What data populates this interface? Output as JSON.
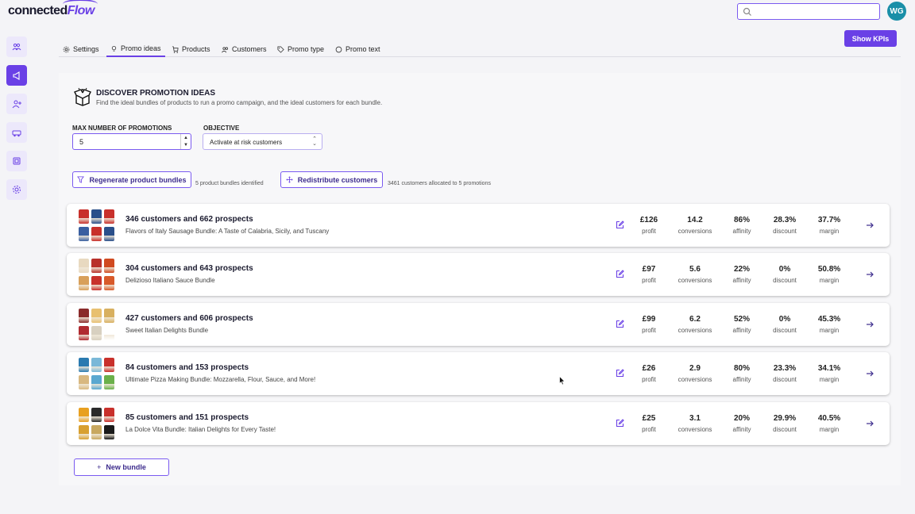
{
  "app": {
    "logo_main": "connected",
    "logo_accent": "Flow"
  },
  "header": {
    "search_placeholder": "",
    "avatar_initials": "WG",
    "show_kpis_label": "Show KPIs"
  },
  "sidebar": {
    "items": [
      {
        "icon": "people-icon",
        "active": false
      },
      {
        "icon": "megaphone-icon",
        "active": true
      },
      {
        "icon": "add-user-icon",
        "active": false
      },
      {
        "icon": "car-icon",
        "active": false
      },
      {
        "icon": "grid-icon",
        "active": false
      },
      {
        "icon": "gear-icon",
        "active": false
      }
    ]
  },
  "tabs": [
    {
      "label": "Settings",
      "icon": "gear-icon"
    },
    {
      "label": "Promo ideas",
      "icon": "lightbulb-icon",
      "active": true
    },
    {
      "label": "Products",
      "icon": "cart-icon"
    },
    {
      "label": "Customers",
      "icon": "users-icon"
    },
    {
      "label": "Promo type",
      "icon": "tag-icon"
    },
    {
      "label": "Promo text",
      "icon": "speech-bubble-icon"
    }
  ],
  "discover": {
    "title": "DISCOVER PROMOTION IDEAS",
    "subtitle": "Find the ideal bundles of products to run a promo campaign, and the ideal customers for each bundle."
  },
  "form": {
    "max_label": "MAX NUMBER OF PROMOTIONS",
    "max_value": "5",
    "objective_label": "OBJECTIVE",
    "objective_value": "Activate at risk customers"
  },
  "actions": {
    "regenerate_label": "Regenerate product bundles",
    "regenerate_hint": "5 product bundles identified",
    "redistribute_label": "Redistribute customers",
    "redistribute_hint": "3461 customers allocated to 5 promotions"
  },
  "metric_labels": {
    "profit": "profit",
    "conversions": "conversions",
    "affinity": "affinity",
    "discount": "discount",
    "margin": "margin"
  },
  "bundles": [
    {
      "title": "346 customers and 662 prospects",
      "subtitle": "Flavors of Italy Sausage Bundle: A Taste of Calabria, Sicily, and Tuscany",
      "profit": "£126",
      "conversions": "14.2",
      "affinity": "86%",
      "discount": "28.3%",
      "margin": "37.7%",
      "colors": [
        "#c8302b",
        "#2a4f8a",
        "#c8302b",
        "#3a5fa0",
        "#c8302b",
        "#2a4f8a"
      ]
    },
    {
      "title": "304 customers and 643 prospects",
      "subtitle": "Delizioso Italiano Sauce Bundle",
      "profit": "£97",
      "conversions": "5.6",
      "affinity": "22%",
      "discount": "0%",
      "margin": "50.8%",
      "colors": [
        "#e8d9c0",
        "#b8302a",
        "#d04a20",
        "#d8a05a",
        "#c8302b",
        "#d85a2a"
      ]
    },
    {
      "title": "427 customers and 606 prospects",
      "subtitle": "Sweet Italian Delights Bundle",
      "profit": "£99",
      "conversions": "6.2",
      "affinity": "52%",
      "discount": "0%",
      "margin": "45.3%",
      "colors": [
        "#8a2a2a",
        "#e8c070",
        "#d8b060",
        "#b02a30",
        "#d8d0c0",
        "#ffffff"
      ]
    },
    {
      "title": "84 customers and 153 prospects",
      "subtitle": "Ultimate Pizza Making Bundle: Mozzarella, Flour, Sauce, and More!",
      "profit": "£26",
      "conversions": "2.9",
      "affinity": "80%",
      "discount": "23.3%",
      "margin": "34.1%",
      "colors": [
        "#2a7ab0",
        "#7ab8d8",
        "#c8302b",
        "#d8b880",
        "#5aa8d0",
        "#6ab04a"
      ]
    },
    {
      "title": "85 customers and 151 prospects",
      "subtitle": "La Dolce Vita Bundle: Italian Delights for Every Taste!",
      "profit": "£25",
      "conversions": "3.1",
      "affinity": "20%",
      "discount": "29.9%",
      "margin": "40.5%",
      "colors": [
        "#e8a020",
        "#2a2a2a",
        "#c8302b",
        "#d8a030",
        "#c8a860",
        "#1a1a1a"
      ]
    }
  ],
  "new_bundle_label": "New bundle",
  "colors": {
    "accent": "#6a40e6",
    "avatar": "#1a8fa8"
  }
}
